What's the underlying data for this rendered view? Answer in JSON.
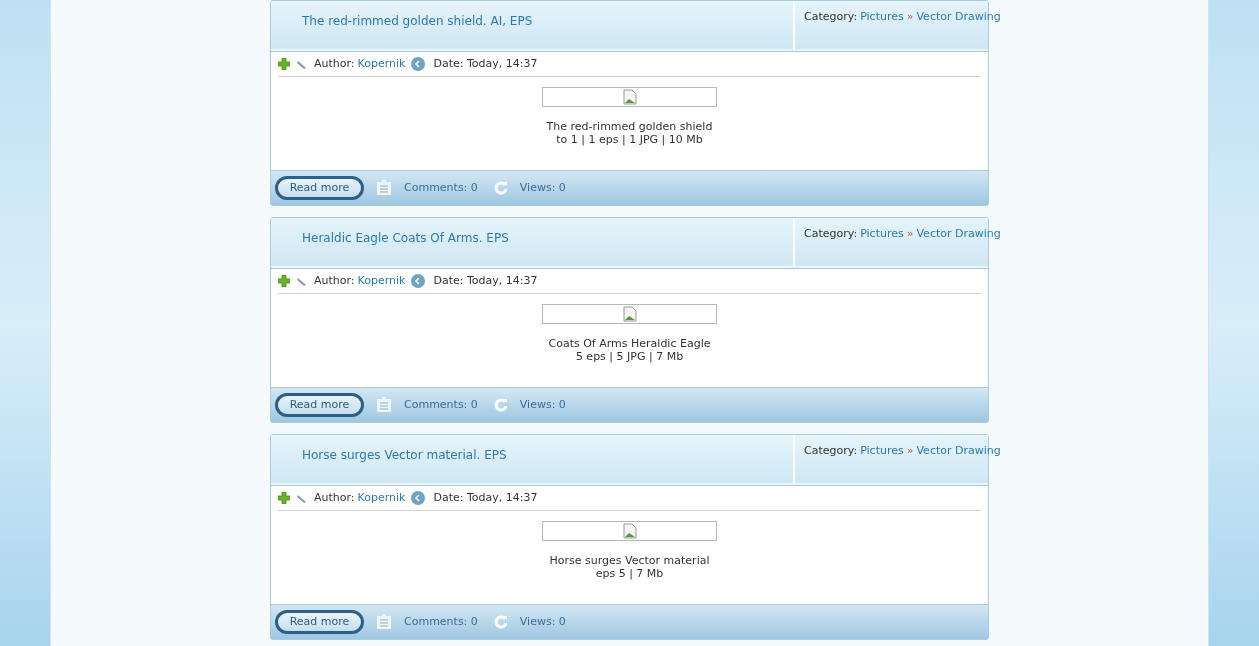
{
  "posts": [
    {
      "title": "The red-rimmed golden shield. AI, EPS",
      "category_label": "Category:",
      "category": "Pictures",
      "subcategory_sep": "»",
      "subcategory": "Vector Drawing",
      "author_label": "Author:",
      "author": "Kopernik",
      "date": "Date: Today, 14:37",
      "caption": "The red-rimmed golden shield",
      "info": "to 1 | 1 eps | 1 JPG | 10 Mb",
      "read_more": "Read more",
      "comments": "Comments: 0",
      "views": "Views: 0"
    },
    {
      "title": "Heraldic Eagle Coats Of Arms. EPS",
      "category_label": "Category:",
      "category": "Pictures",
      "subcategory_sep": "»",
      "subcategory": "Vector Drawing",
      "author_label": "Author:",
      "author": "Kopernik",
      "date": "Date: Today, 14:37",
      "caption": "Coats Of Arms Heraldic Eagle",
      "info": "5 eps | 5 JPG | 7 Mb",
      "read_more": "Read more",
      "comments": "Comments: 0",
      "views": "Views: 0"
    },
    {
      "title": "Horse surges Vector material. EPS",
      "category_label": "Category:",
      "category": "Pictures",
      "subcategory_sep": "»",
      "subcategory": "Vector Drawing",
      "author_label": "Author:",
      "author": "Kopernik",
      "date": "Date: Today, 14:37",
      "caption": "Horse surges Vector material",
      "info": "eps 5 | 7 Mb",
      "read_more": "Read more",
      "comments": "Comments: 0",
      "views": "Views: 0"
    }
  ]
}
